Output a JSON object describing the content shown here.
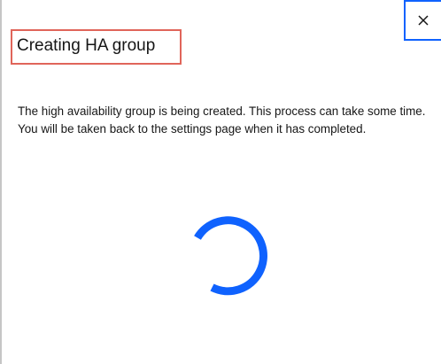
{
  "modal": {
    "title": "Creating HA group",
    "description": "The high availability group is being created. This process can take some time. You will be taken back to the settings page when it has completed.",
    "close_icon": "close-icon",
    "loading_icon": "loading-spinner-icon"
  },
  "colors": {
    "accent": "#0f62fe",
    "highlight": "#e0655a",
    "text": "#161616"
  }
}
